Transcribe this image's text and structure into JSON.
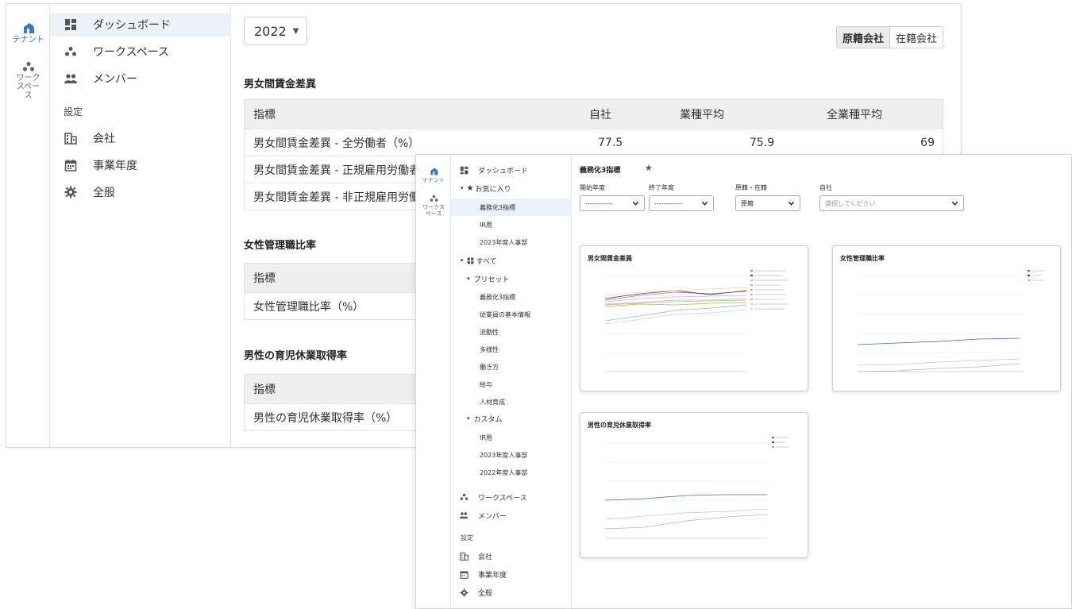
{
  "colors": {
    "accent": "#3a78c3",
    "active_bg": "#edf2f9",
    "header_bg": "#efefef"
  },
  "back": {
    "rail": {
      "tenant_label": "テナント",
      "workspace_label": "ワークスペース"
    },
    "sidebar": {
      "items": [
        {
          "label": "ダッシュボード",
          "icon": "dashboard-icon"
        },
        {
          "label": "ワークスペース",
          "icon": "workspace-icon"
        },
        {
          "label": "メンバー",
          "icon": "members-icon"
        }
      ],
      "settings_heading": "設定",
      "settings_items": [
        {
          "label": "会社",
          "icon": "building-icon"
        },
        {
          "label": "事業年度",
          "icon": "calendar-icon"
        },
        {
          "label": "全般",
          "icon": "gear-icon"
        }
      ]
    },
    "main": {
      "year": "2022",
      "toggle": [
        "原籍会社",
        "在籍会社"
      ],
      "sections": [
        {
          "title": "男女間賃金差異",
          "headers": [
            "指標",
            "自社",
            "業種平均",
            "全業種平均"
          ],
          "rows": [
            [
              "男女間賃金差異 - 全労働者（%）",
              "77.5",
              "75.9",
              "69"
            ],
            [
              "男女間賃金差異 - 正規雇用労働者",
              "",
              "",
              ""
            ],
            [
              "男女間賃金差異 - 非正規雇用労働者",
              "",
              "",
              ""
            ]
          ]
        },
        {
          "title": "女性管理職比率",
          "headers": [
            "指標"
          ],
          "rows": [
            [
              "女性管理職比率（%）"
            ]
          ]
        },
        {
          "title": "男性の育児休業取得率",
          "headers": [
            "指標"
          ],
          "rows": [
            [
              "男性の育児休業取得率（%）"
            ]
          ]
        }
      ]
    }
  },
  "front": {
    "rail": {
      "tenant_label": "テナント",
      "workspace_label": "ワークスペース"
    },
    "sidebar": {
      "dashboard": "ダッシュボード",
      "favorites": "お気に入り",
      "favorite_items": [
        "義務化3指標",
        "IR用",
        "2023年度人事部"
      ],
      "all": "すべて",
      "preset": "プリセット",
      "preset_items": [
        "義務化3指標",
        "従業員の基本情報",
        "流動性",
        "多様性",
        "働き方",
        "給与",
        "人材育成"
      ],
      "custom": "カスタム",
      "custom_items": [
        "IR用",
        "2023年度人事部",
        "2022年度人事部"
      ],
      "workspace": "ワークスペース",
      "members": "メンバー",
      "settings_heading": "設定",
      "settings_items": [
        "会社",
        "事業年度",
        "全般"
      ]
    },
    "main": {
      "title": "義務化3指標",
      "filters": [
        {
          "label": "開始年度",
          "value": "------------"
        },
        {
          "label": "終了年度",
          "value": "------------"
        },
        {
          "label": "原籍・在籍",
          "value": "原籍"
        },
        {
          "label": "自社",
          "value": "選択してください"
        }
      ],
      "cards": [
        {
          "title": "男女間賃金差異"
        },
        {
          "title": "女性管理職比率"
        },
        {
          "title": "男性の育児休業取得率"
        }
      ]
    }
  }
}
